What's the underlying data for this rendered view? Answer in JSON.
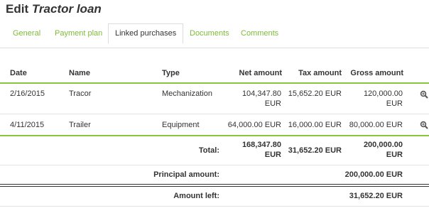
{
  "page": {
    "title_prefix": "Edit",
    "title_name": "Tractor loan"
  },
  "tabs": [
    {
      "label": "General"
    },
    {
      "label": "Payment plan"
    },
    {
      "label": "Linked purchases"
    },
    {
      "label": "Documents"
    },
    {
      "label": "Comments"
    }
  ],
  "active_tab": "Linked purchases",
  "table": {
    "headers": {
      "date": "Date",
      "name": "Name",
      "type": "Type",
      "net": "Net amount",
      "tax": "Tax amount",
      "gross": "Gross amount"
    },
    "rows": [
      {
        "date": "2/16/2015",
        "name": "Tracor",
        "type": "Mechanization",
        "net": "104,347.80",
        "net_cur": "EUR",
        "tax": "15,652.20 EUR",
        "gross": "120,000.00",
        "gross_cur": "EUR",
        "action_icon": "zoom-icon"
      },
      {
        "date": "4/11/2015",
        "name": "Trailer",
        "type": "Equipment",
        "net": "64,000.00 EUR",
        "tax": "16,000.00 EUR",
        "gross": "80,000.00 EUR",
        "action_icon": "zoom-icon"
      }
    ],
    "total": {
      "label": "Total:",
      "net": "168,347.80",
      "net_cur": "EUR",
      "tax": "31,652.20 EUR",
      "gross": "200,000.00",
      "gross_cur": "EUR"
    },
    "principal": {
      "label": "Principal amount:",
      "value": "200,000.00 EUR"
    },
    "left": {
      "label": "Amount left:",
      "value": "31,652.20 EUR"
    }
  },
  "colors": {
    "accent": "#8cc63f",
    "tab_text": "#7fba3a",
    "text": "#333333"
  }
}
